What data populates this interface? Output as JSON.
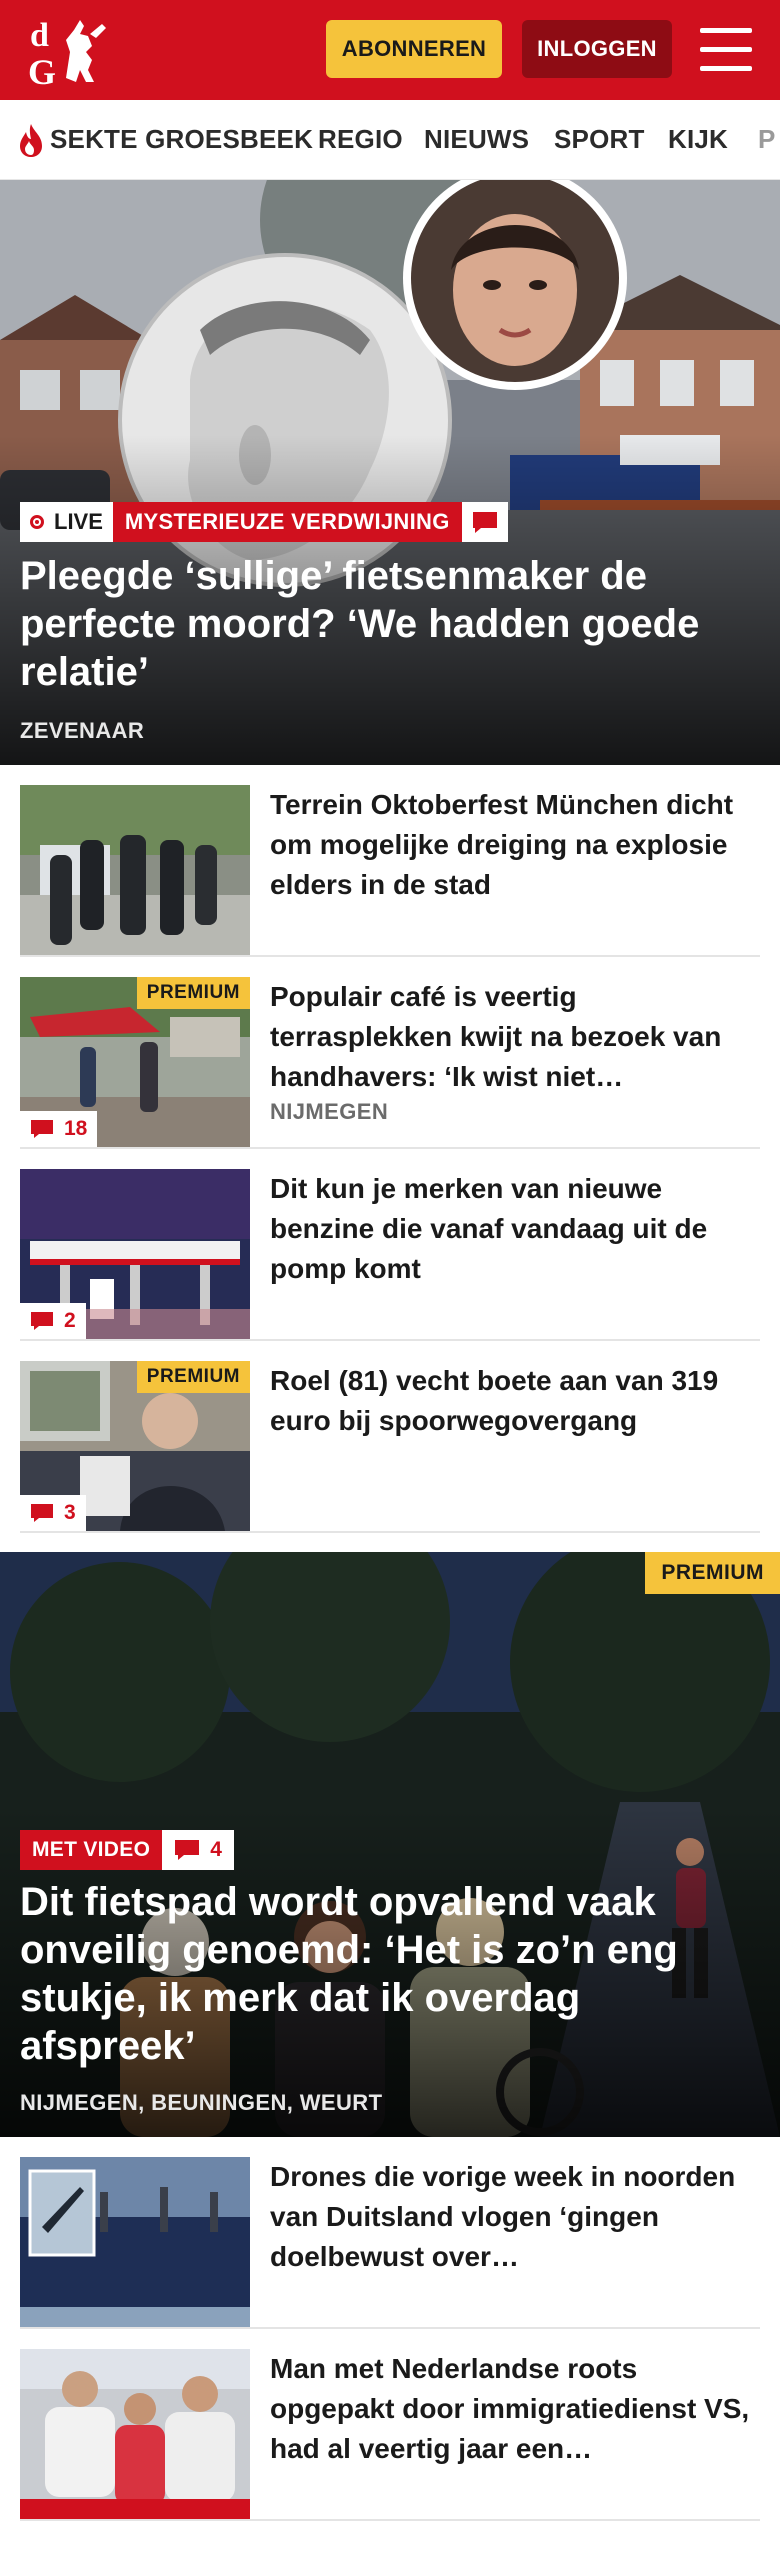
{
  "header": {
    "subscribe_label": "ABONNEREN",
    "login_label": "INLOGGEN",
    "logo_letters": "dG",
    "brand_color": "#d0101e",
    "accent_color": "#f5c33b"
  },
  "nav": {
    "items": [
      {
        "label": "SEKTE GROESBEEK",
        "icon": "flame-icon"
      },
      {
        "label": "REGIO"
      },
      {
        "label": "NIEUWS"
      },
      {
        "label": "SPORT"
      },
      {
        "label": "KIJK"
      },
      {
        "label": "P"
      }
    ]
  },
  "hero": {
    "live_label": "LIVE",
    "tag": "MYSTERIEUZE VERDWIJNING",
    "title": "Pleegde ‘sullige’ fietsenmaker de perfecte moord? ‘We hadden goede relatie’",
    "location": "ZEVENAAR"
  },
  "articles": [
    {
      "title": "Terrein Oktoberfest München dicht om mogelijke dreiging na explosie elders in de stad",
      "location": "",
      "premium": "",
      "comments": ""
    },
    {
      "title": "Populair café is veertig terrasplekken kwijt na bezoek van handhavers: ‘Ik wist niet…",
      "location": "NIJMEGEN",
      "premium": "PREMIUM",
      "comments": "18"
    },
    {
      "title": "Dit kun je merken van nieuwe benzine die vanaf vandaag uit de pomp komt",
      "location": "",
      "premium": "",
      "comments": "2"
    },
    {
      "title": "Roel (81) vecht boete aan van 319 euro bij spoorwegovergang",
      "location": "",
      "premium": "PREMIUM",
      "comments": "3"
    }
  ],
  "hero2": {
    "premium": "PREMIUM",
    "video_label": "MET VIDEO",
    "comments": "4",
    "title": "Dit fietspad wordt opvallend vaak onveilig genoemd: ‘Het is zo’n eng stukje, ik merk dat ik overdag afspreek’",
    "location": "NIJMEGEN, BEUNINGEN, WEURT"
  },
  "articles2": [
    {
      "title": "Drones die vorige week in noorden van Duitsland vlogen ‘gingen doelbewust over…"
    },
    {
      "title": "Man met Nederlandse roots opgepakt door immigratiedienst VS, had al veertig jaar een…"
    }
  ]
}
